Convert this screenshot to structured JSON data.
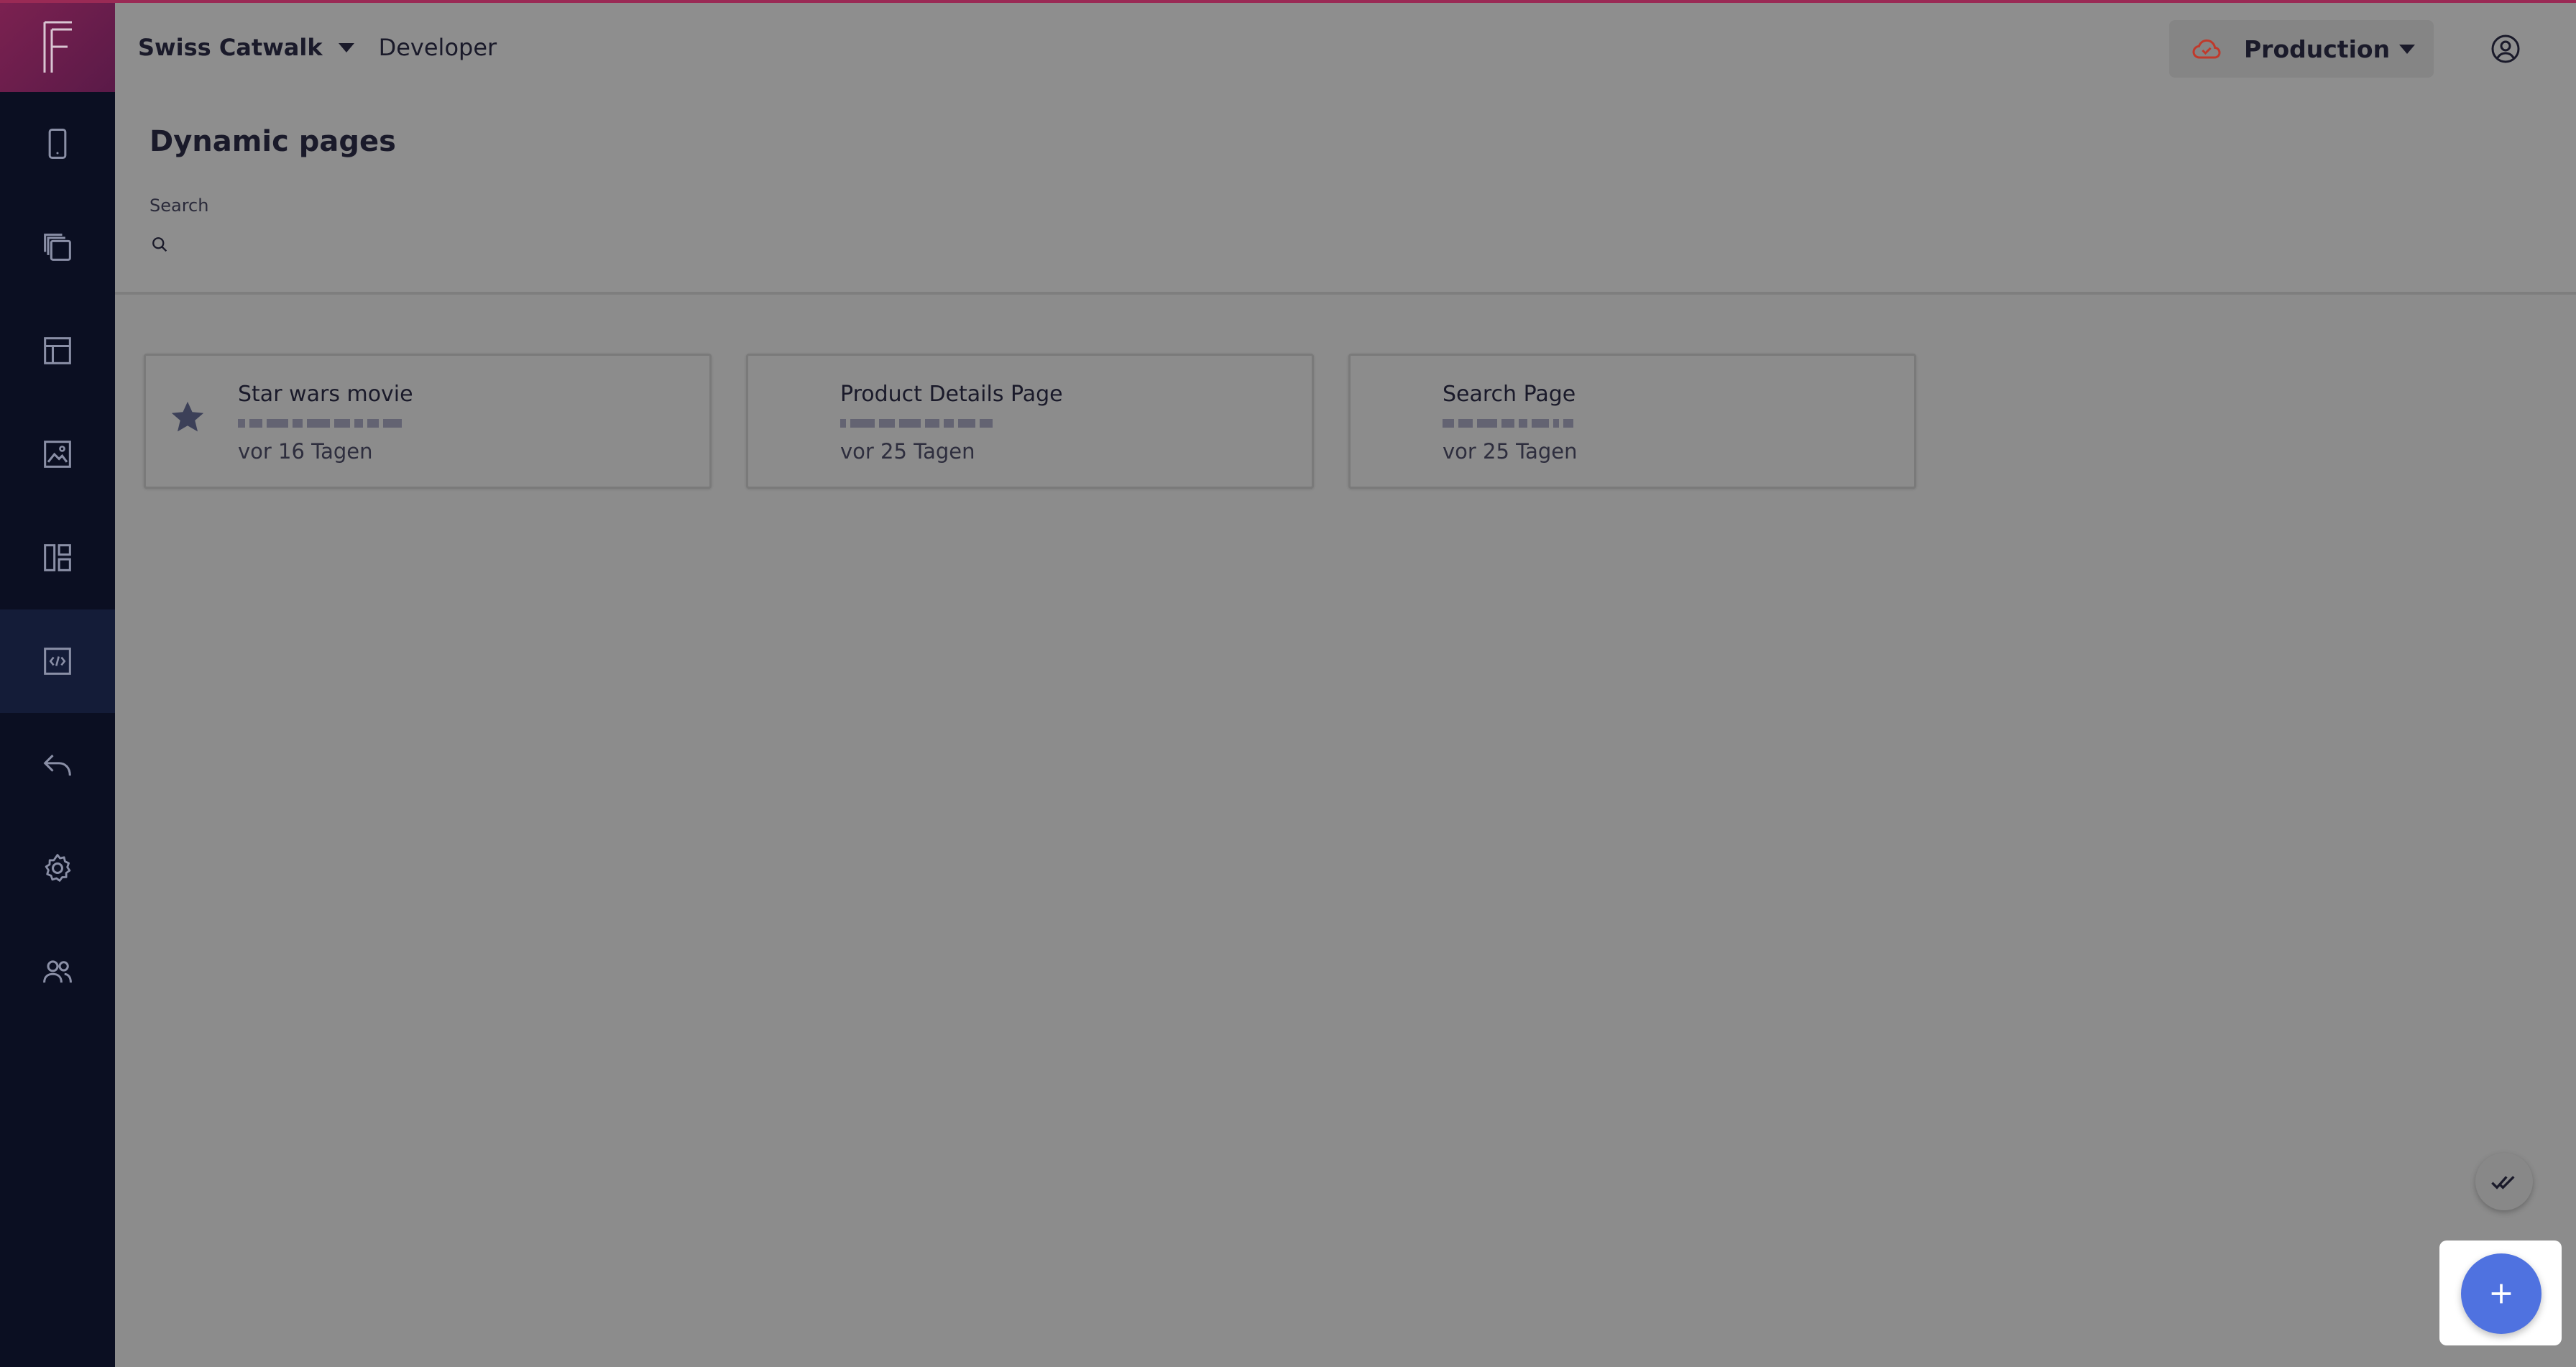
{
  "topbar": {
    "project_name": "Swiss Catwalk",
    "role": "Developer",
    "environment": "Production",
    "environment_icon": "cloud-icon",
    "user_icon": "user-circle-icon"
  },
  "sidebar": {
    "logo": "F",
    "items": [
      {
        "icon": "mobile-icon",
        "active": false
      },
      {
        "icon": "pages-copy-icon",
        "active": false
      },
      {
        "icon": "layout-icon",
        "active": false
      },
      {
        "icon": "image-icon",
        "active": false
      },
      {
        "icon": "dashboard-icon",
        "active": false
      },
      {
        "icon": "code-icon",
        "active": true
      },
      {
        "icon": "undo-icon",
        "active": false
      },
      {
        "icon": "gear-icon",
        "active": false
      },
      {
        "icon": "users-icon",
        "active": false
      }
    ]
  },
  "page": {
    "title": "Dynamic pages",
    "search_label": "Search",
    "search_value": "",
    "search_placeholder": ""
  },
  "cards": [
    {
      "title": "Star wars movie",
      "time": "vor 16 Tagen",
      "starred": true
    },
    {
      "title": "Product Details Page",
      "time": "vor 25 Tagen",
      "starred": false
    },
    {
      "title": "Search Page",
      "time": "vor 25 Tagen",
      "starred": false
    }
  ],
  "fabs": {
    "check_icon": "double-check-icon",
    "add_icon": "plus-icon"
  },
  "colors": {
    "sidebar_bg": "#0b0f22",
    "brand_accent": "#9a2a55",
    "fab_blue": "#4f72e0",
    "cloud_red": "#c0392b"
  }
}
